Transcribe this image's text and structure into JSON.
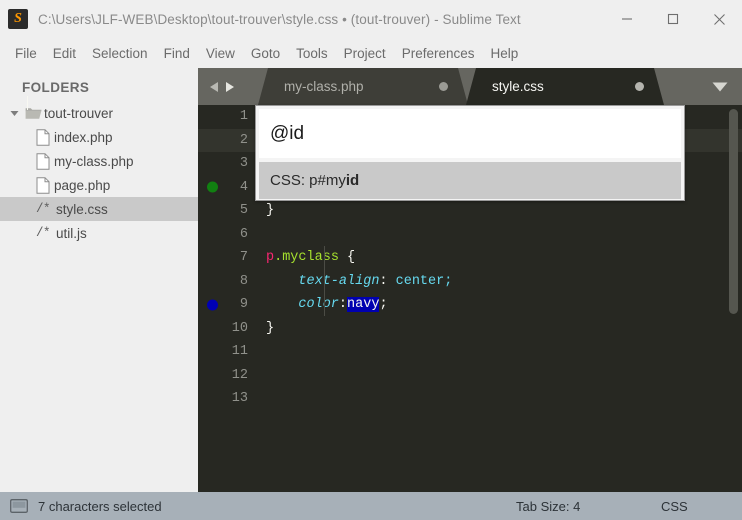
{
  "window": {
    "app_icon": "sublime-text-icon",
    "glyph": "S",
    "title": "C:\\Users\\JLF-WEB\\Desktop\\tout-trouver\\style.css • (tout-trouver) - Sublime Text",
    "controls": [
      {
        "name": "minimize-button",
        "label": "Minimize"
      },
      {
        "name": "maximize-button",
        "label": "Maximize"
      },
      {
        "name": "close-button",
        "label": "Close"
      }
    ]
  },
  "menubar": {
    "items": [
      {
        "label": "File"
      },
      {
        "label": "Edit"
      },
      {
        "label": "Selection"
      },
      {
        "label": "Find"
      },
      {
        "label": "View"
      },
      {
        "label": "Goto"
      },
      {
        "label": "Tools"
      },
      {
        "label": "Project"
      },
      {
        "label": "Preferences"
      },
      {
        "label": "Help"
      }
    ]
  },
  "sidebar": {
    "heading": "FOLDERS",
    "folder": {
      "label": "tout-trouver",
      "expanded": true
    },
    "files": [
      {
        "label": "index.php",
        "icon": "file-page-icon",
        "selected": false
      },
      {
        "label": "my-class.php",
        "icon": "file-page-icon",
        "selected": false
      },
      {
        "label": "page.php",
        "icon": "file-page-icon",
        "selected": false
      },
      {
        "label": "style.css",
        "icon": "file-code-icon",
        "icon_text": "/*",
        "selected": true
      },
      {
        "label": "util.js",
        "icon": "file-code-icon",
        "icon_text": "/*",
        "selected": false
      }
    ]
  },
  "tabbar": {
    "nav_prev": "prev-tab-arrow",
    "nav_next": "next-tab-arrow",
    "tabs": [
      {
        "label": "my-class.php",
        "active": false,
        "dirty": true
      },
      {
        "label": "style.css",
        "active": true,
        "dirty": true
      }
    ],
    "overflow_menu": "tab-overflow-chevron"
  },
  "editor": {
    "syntax": "CSS",
    "current_line": 2,
    "line_numbers": [
      "1",
      "2",
      "3",
      "4",
      "5",
      "6",
      "7",
      "8",
      "9",
      "10",
      "11",
      "12",
      "13"
    ],
    "markers": [
      {
        "line": 4,
        "color": "#118011",
        "name": "gutter-marker-green"
      },
      {
        "line": 9,
        "color": "#0000b4",
        "name": "gutter-marker-blue"
      }
    ],
    "visible_code": {
      "line5": "}",
      "line7_tag": "p",
      "line7_class": ".myclass",
      "line7_brace": " {",
      "line8_prop": "text-align",
      "line8_colon": ": ",
      "line8_val": "center;",
      "line9_prop": "color",
      "line9_colon": ":",
      "line9_sel": "navy",
      "line9_semi": ";",
      "line10": "}"
    }
  },
  "popup": {
    "name": "autocomplete-popup",
    "input_value": "@id",
    "suggestion_prefix": "CSS: p#my",
    "suggestion_bold": "id"
  },
  "statusbar": {
    "panel_icon": "console-toggle-icon",
    "selection": "7 characters selected",
    "tab_size": "Tab Size: 4",
    "syntax": "CSS"
  },
  "colors": {
    "accent_orange": "#ff9800",
    "editor_bg": "#272822",
    "tabbar_bg": "#666660",
    "status_bg": "#a7b0b8",
    "selection_blue": "#0000b0",
    "tag_pink": "#f92672",
    "class_green": "#a6e22e",
    "prop_cyan": "#66d9ef"
  }
}
